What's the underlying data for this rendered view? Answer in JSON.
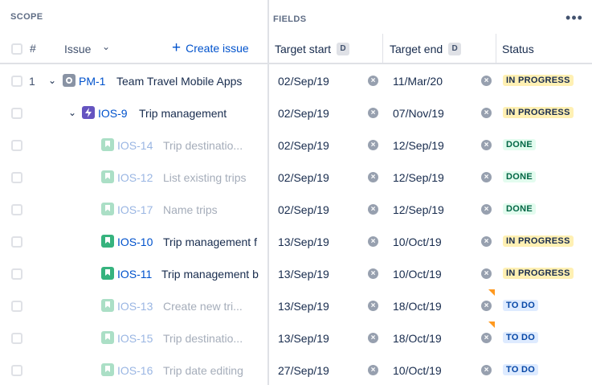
{
  "header": {
    "scope_label": "SCOPE",
    "fields_label": "FIELDS",
    "more_label": "•••",
    "hash_label": "#",
    "issue_label": "Issue",
    "create_label": "Create issue",
    "columns": {
      "target_start": "Target start",
      "target_end": "Target end",
      "status": "Status",
      "badge": "D"
    }
  },
  "colors": {
    "link": "#0052cc",
    "in_progress_bg": "#fff0b3",
    "done_bg": "#e3fcef",
    "todo_bg": "#deebff",
    "flag": "#ff991f"
  },
  "rows": [
    {
      "num": "1",
      "key": "PM-1",
      "summary": "Team Travel Mobile Apps",
      "start": "02/Sep/19",
      "end": "11/Mar/20",
      "status": "IN PROGRESS",
      "icon": "initiative-icon"
    },
    {
      "num": "",
      "key": "IOS-9",
      "summary": "Trip management",
      "start": "02/Sep/19",
      "end": "07/Nov/19",
      "status": "IN PROGRESS",
      "icon": "epic-lightning-icon"
    },
    {
      "num": "",
      "key": "IOS-14",
      "summary": "Trip destinatio...",
      "start": "02/Sep/19",
      "end": "12/Sep/19",
      "status": "DONE",
      "icon": "story-bookmark-icon"
    },
    {
      "num": "",
      "key": "IOS-12",
      "summary": "List existing trips",
      "start": "02/Sep/19",
      "end": "12/Sep/19",
      "status": "DONE",
      "icon": "story-bookmark-icon"
    },
    {
      "num": "",
      "key": "IOS-17",
      "summary": "Name trips",
      "start": "02/Sep/19",
      "end": "12/Sep/19",
      "status": "DONE",
      "icon": "story-bookmark-icon"
    },
    {
      "num": "",
      "key": "IOS-10",
      "summary": "Trip management f",
      "start": "13/Sep/19",
      "end": "10/Oct/19",
      "status": "IN PROGRESS",
      "icon": "story-bookmark-icon"
    },
    {
      "num": "",
      "key": "IOS-11",
      "summary": "Trip management b",
      "start": "13/Sep/19",
      "end": "10/Oct/19",
      "status": "IN PROGRESS",
      "icon": "story-bookmark-icon"
    },
    {
      "num": "",
      "key": "IOS-13",
      "summary": "Create new tri...",
      "start": "13/Sep/19",
      "end": "18/Oct/19",
      "status": "TO DO",
      "icon": "story-bookmark-icon"
    },
    {
      "num": "",
      "key": "IOS-15",
      "summary": "Trip destinatio...",
      "start": "13/Sep/19",
      "end": "18/Oct/19",
      "status": "TO DO",
      "icon": "story-bookmark-icon"
    },
    {
      "num": "",
      "key": "IOS-16",
      "summary": "Trip date editing",
      "start": "27/Sep/19",
      "end": "10/Oct/19",
      "status": "TO DO",
      "icon": "story-bookmark-icon"
    }
  ]
}
